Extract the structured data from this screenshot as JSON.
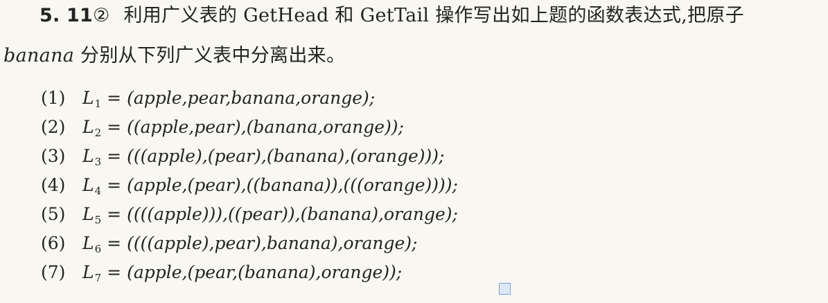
{
  "heading": {
    "problem_number": "5. 11",
    "difficulty": "②",
    "text_line1": "利用广义表的 GetHead 和 GetTail 操作写出如上题的函数表达式,把原子",
    "line2_atom": "banana",
    "text_line2": "分别从下列广义表中分离出来。"
  },
  "items": [
    {
      "num": "(1)",
      "name": "L",
      "sub": "1",
      "eq": "=",
      "expr": "(apple,pear,banana,orange);"
    },
    {
      "num": "(2)",
      "name": "L",
      "sub": "2",
      "eq": "=",
      "expr": "((apple,pear),(banana,orange));"
    },
    {
      "num": "(3)",
      "name": "L",
      "sub": "3",
      "eq": "=",
      "expr": "(((apple),(pear),(banana),(orange)));"
    },
    {
      "num": "(4)",
      "name": "L",
      "sub": "4",
      "eq": "=",
      "expr": "(apple,(pear),((banana)),(((orange))));"
    },
    {
      "num": "(5)",
      "name": "L",
      "sub": "5",
      "eq": "=",
      "expr": "((((apple))),((pear)),(banana),orange);"
    },
    {
      "num": "(6)",
      "name": "L",
      "sub": "6",
      "eq": "=",
      "expr": "((((apple),pear),banana),orange);"
    },
    {
      "num": "(7)",
      "name": "L",
      "sub": "7",
      "eq": "=",
      "expr": "(apple,(pear,(banana),orange));"
    }
  ]
}
